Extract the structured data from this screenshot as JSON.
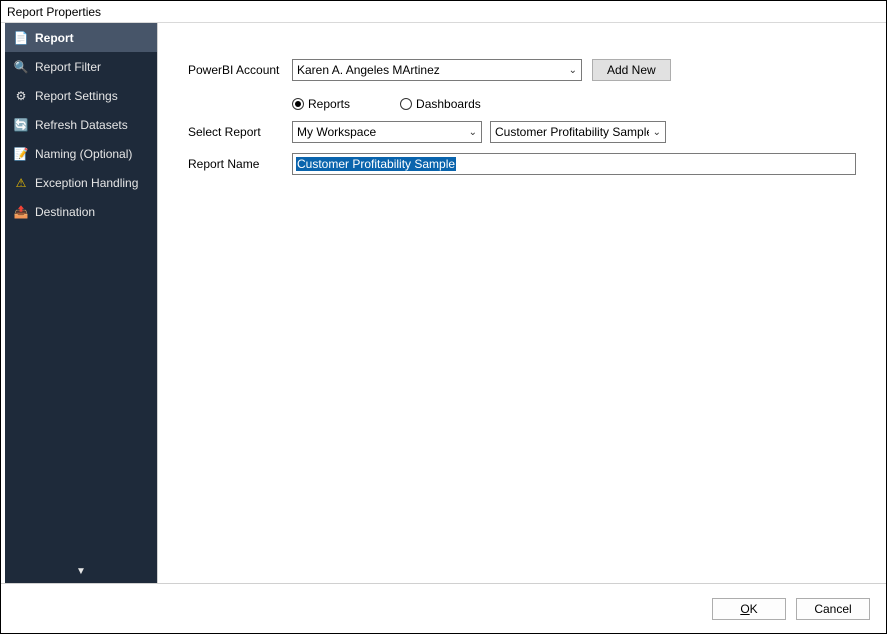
{
  "window": {
    "title": "Report Properties"
  },
  "sidebar": {
    "items": [
      {
        "label": "Report",
        "icon": "📄",
        "active": true
      },
      {
        "label": "Report Filter",
        "icon": "🔍",
        "active": false
      },
      {
        "label": "Report Settings",
        "icon": "⚙",
        "active": false
      },
      {
        "label": "Refresh Datasets",
        "icon": "🔄",
        "active": false
      },
      {
        "label": "Naming (Optional)",
        "icon": "📝",
        "active": false
      },
      {
        "label": "Exception Handling",
        "icon": "⚠",
        "active": false
      },
      {
        "label": "Destination",
        "icon": "📤",
        "active": false
      }
    ],
    "expand_glyph": "▼"
  },
  "form": {
    "account_label": "PowerBI Account",
    "account_value": "Karen A. Angeles MArtinez",
    "add_new_label": "Add New",
    "type_radio": {
      "reports": "Reports",
      "dashboards": "Dashboards",
      "selected": "reports"
    },
    "select_report_label": "Select Report",
    "workspace_value": "My Workspace",
    "report_select_value": "Customer Profitability Sample",
    "report_name_label": "Report Name",
    "report_name_value": "Customer Profitability Sample"
  },
  "footer": {
    "ok": "OK",
    "cancel": "Cancel"
  },
  "colors": {
    "sidebar_bg": "#1e2a3a",
    "sidebar_active": "#475569",
    "selection_bg": "#0a64ad"
  }
}
